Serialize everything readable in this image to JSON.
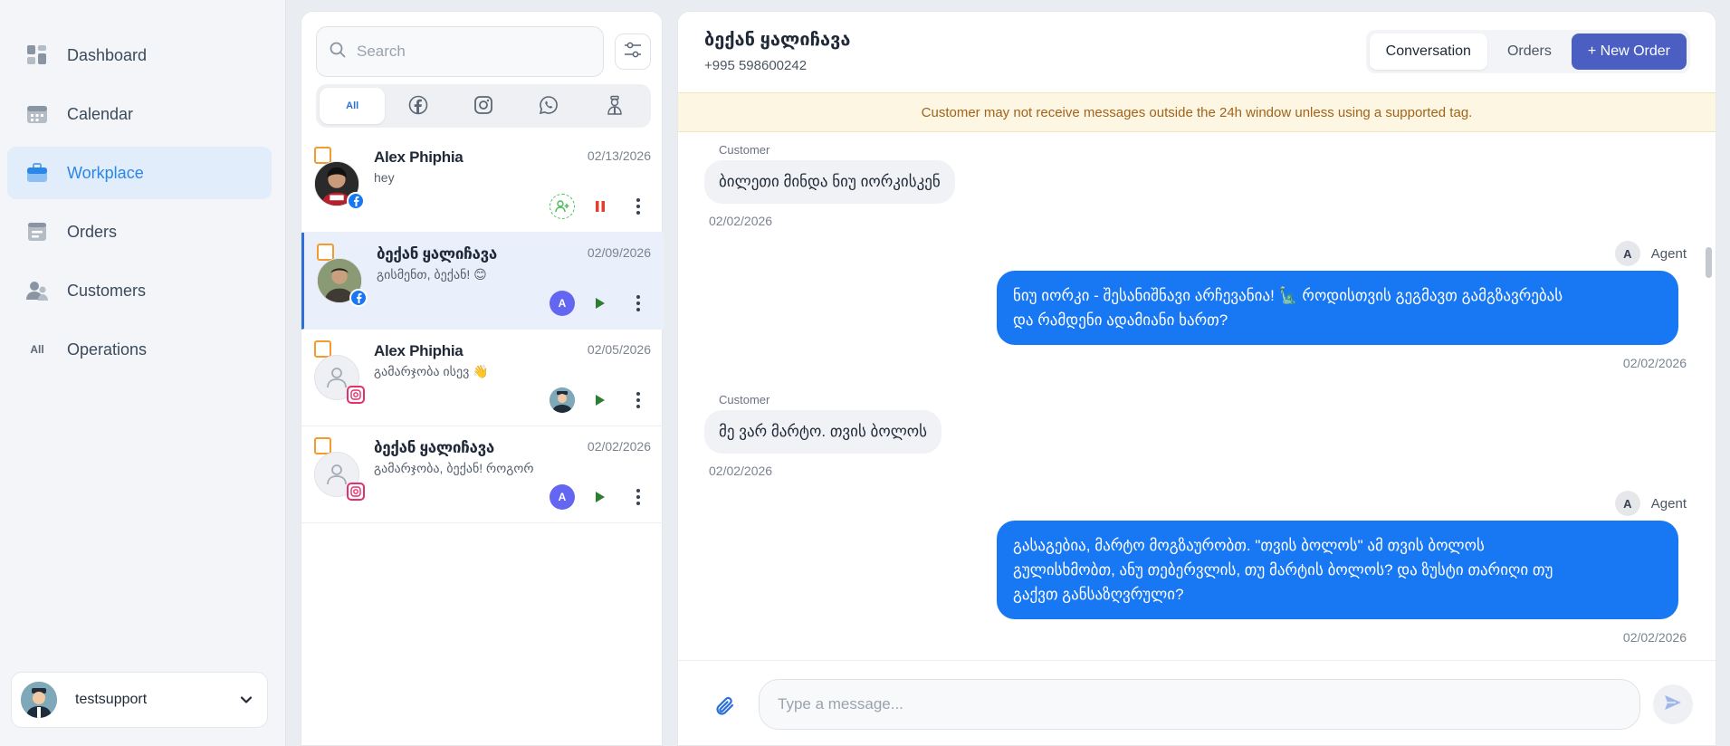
{
  "nav": {
    "items": [
      {
        "label": "Dashboard",
        "icon": "dashboard-icon"
      },
      {
        "label": "Calendar",
        "icon": "calendar-icon"
      },
      {
        "label": "Workplace",
        "icon": "briefcase-icon",
        "active": true
      },
      {
        "label": "Orders",
        "icon": "orders-icon"
      },
      {
        "label": "Customers",
        "icon": "customers-icon"
      },
      {
        "label": "Operations",
        "icon": "all-icon",
        "icon_text": "All"
      }
    ],
    "user": {
      "name": "testsupport"
    }
  },
  "list": {
    "search_placeholder": "Search",
    "channel_tabs": [
      {
        "label": "All",
        "active": true
      },
      {
        "icon": "facebook-icon"
      },
      {
        "icon": "instagram-icon"
      },
      {
        "icon": "whatsapp-icon"
      },
      {
        "icon": "agent-icon"
      }
    ],
    "conversations": [
      {
        "name": "Alex Phiphia",
        "preview": "hey",
        "date": "02/13/2026",
        "channel": "facebook",
        "assignee": "assign-user",
        "action": "pause"
      },
      {
        "name": "ბექან ყალიჩავა",
        "preview": "გისმენთ, ბექან! 😊",
        "date": "02/09/2026",
        "channel": "facebook",
        "assignee": "A",
        "action": "play",
        "selected": true
      },
      {
        "name": "Alex Phiphia",
        "preview": "გამარჯობა ისევ 👋",
        "date": "02/05/2026",
        "channel": "instagram",
        "assignee": "agent-avatar",
        "action": "play"
      },
      {
        "name": "ბექან ყალიჩავა",
        "preview": "გამარჯობა, ბექან! როგორ",
        "date": "02/02/2026",
        "channel": "instagram",
        "assignee": "A",
        "action": "play"
      }
    ]
  },
  "chat": {
    "contact_name": "ბექან ყალიჩავა",
    "contact_phone": "+995 598600242",
    "tabs": {
      "conversation": "Conversation",
      "orders": "Orders",
      "new_order": "+ New Order"
    },
    "warning": "Customer may not receive messages outside the 24h window unless using a supported tag.",
    "messages": [
      {
        "from": "Customer",
        "text": "ბილეთი მინდა ნიუ იორკისკენ",
        "time": "02/02/2026"
      },
      {
        "from": "Agent",
        "avatar": "A",
        "line1": "ნიუ იორკი - შესანიშნავი არჩევანია! 🗽 როდისთვის გეგმავთ გამგზავრებას",
        "line2": "და რამდენი ადამიანი ხართ?",
        "time": "02/02/2026"
      },
      {
        "from": "Customer",
        "text": "მე ვარ მარტო. თვის ბოლოს",
        "time": "02/02/2026"
      },
      {
        "from": "Agent",
        "avatar": "A",
        "line1": "გასაგებია, მარტო მოგზაურობთ. \"თვის ბოლოს\" ამ თვის ბოლოს",
        "line2": "გულისხმობთ, ანუ თებერვლის, თუ მარტის ბოლოს? და ზუსტი თარიღი თუ",
        "line3": "გაქვთ განსაზღვრული?",
        "time": "02/02/2026"
      }
    ],
    "composer_placeholder": "Type a message..."
  },
  "colors": {
    "accent": "#1877f2",
    "nav_active_bg": "#e1edfb",
    "primary_button": "#4a5fc1",
    "warning_bg": "#fdf6e3"
  }
}
